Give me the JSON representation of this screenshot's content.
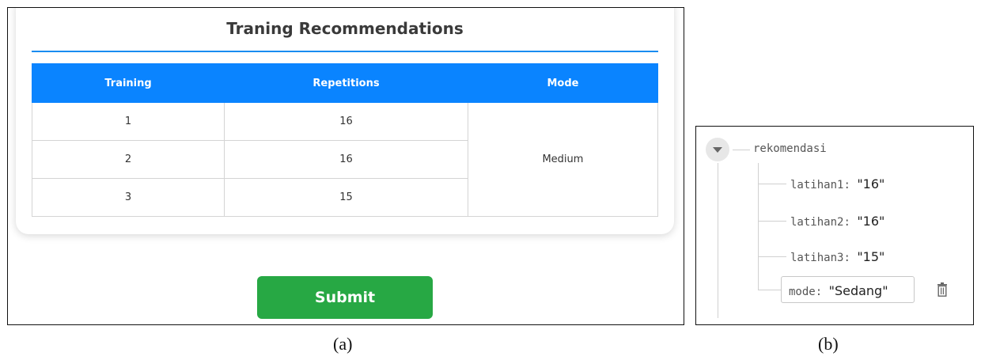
{
  "panel_a": {
    "title": "Traning Recommendations",
    "table": {
      "headers": [
        "Training",
        "Repetitions",
        "Mode"
      ],
      "rows": [
        {
          "training": "1",
          "repetitions": "16"
        },
        {
          "training": "2",
          "repetitions": "16"
        },
        {
          "training": "3",
          "repetitions": "15"
        }
      ],
      "mode": "Medium"
    },
    "submit_label": "Submit"
  },
  "panel_b": {
    "root_key": "rekomendasi",
    "children": [
      {
        "key": "latihan1",
        "value": "\"16\""
      },
      {
        "key": "latihan2",
        "value": "\"16\""
      },
      {
        "key": "latihan3",
        "value": "\"15\""
      },
      {
        "key": "mode",
        "value": "\"Sedang\""
      }
    ],
    "separator": ":"
  },
  "captions": {
    "a": "(a)",
    "b": "(b)"
  },
  "colors": {
    "header_blue": "#0a84ff",
    "rule_blue": "#1a8cf0",
    "submit_green": "#27a844"
  },
  "icons": {
    "toggle": "chevron-down-icon",
    "delete": "trash-icon"
  }
}
